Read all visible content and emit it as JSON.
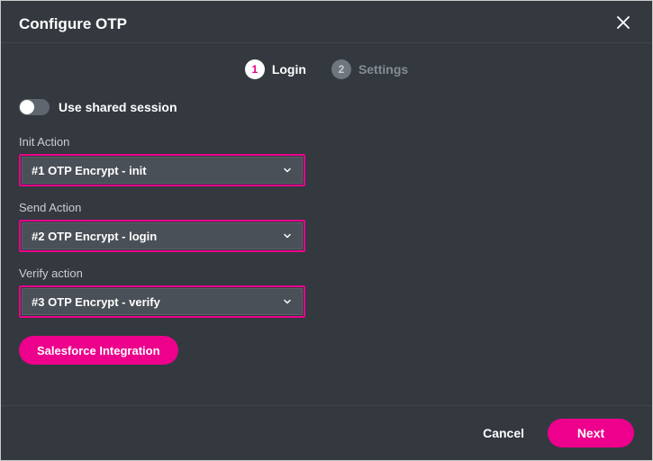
{
  "colors": {
    "accent": "#ec008c",
    "bg": "#33393f"
  },
  "header": {
    "title": "Configure OTP"
  },
  "steps": {
    "active": {
      "num": "1",
      "label": "Login"
    },
    "inactive": {
      "num": "2",
      "label": "Settings"
    }
  },
  "toggle": {
    "label": "Use shared session",
    "on": false
  },
  "fields": {
    "init": {
      "label": "Init Action",
      "value": "#1 OTP Encrypt - init"
    },
    "send": {
      "label": "Send Action",
      "value": "#2 OTP Encrypt - login"
    },
    "verify": {
      "label": "Verify action",
      "value": "#3 OTP Encrypt - verify"
    }
  },
  "buttons": {
    "salesforce": "Salesforce Integration",
    "cancel": "Cancel",
    "next": "Next"
  }
}
